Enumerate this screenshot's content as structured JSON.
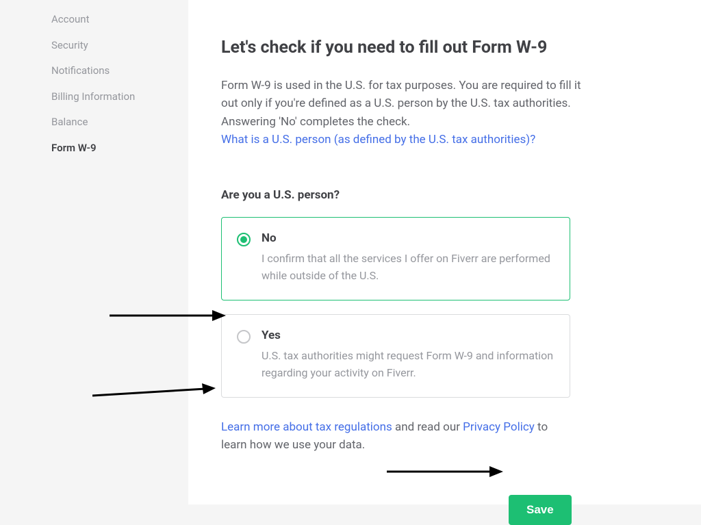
{
  "sidebar": {
    "items": [
      {
        "label": "Account",
        "active": false
      },
      {
        "label": "Security",
        "active": false
      },
      {
        "label": "Notifications",
        "active": false
      },
      {
        "label": "Billing Information",
        "active": false
      },
      {
        "label": "Balance",
        "active": false
      },
      {
        "label": "Form W-9",
        "active": true
      }
    ]
  },
  "main": {
    "title": "Let's check if you need to fill out Form W-9",
    "description": "Form W-9 is used in the U.S. for tax purposes. You are required to fill it out only if you're defined as a U.S. person by the U.S. tax authorities. Answering 'No' completes the check.",
    "description_link": "What is a U.S. person (as defined by the U.S. tax authorities)?",
    "question": "Are you a U.S. person?",
    "options": [
      {
        "label": "No",
        "desc": "I confirm that all the services I offer on Fiverr are performed while outside of the U.S.",
        "selected": true
      },
      {
        "label": "Yes",
        "desc": "U.S. tax authorities might request Form W-9 and information regarding your activity on Fiverr.",
        "selected": false
      }
    ],
    "footer": {
      "link1": "Learn more about tax regulations",
      "mid": " and read our ",
      "link2": "Privacy Policy",
      "tail": " to learn how we use your data."
    },
    "save_label": "Save"
  }
}
